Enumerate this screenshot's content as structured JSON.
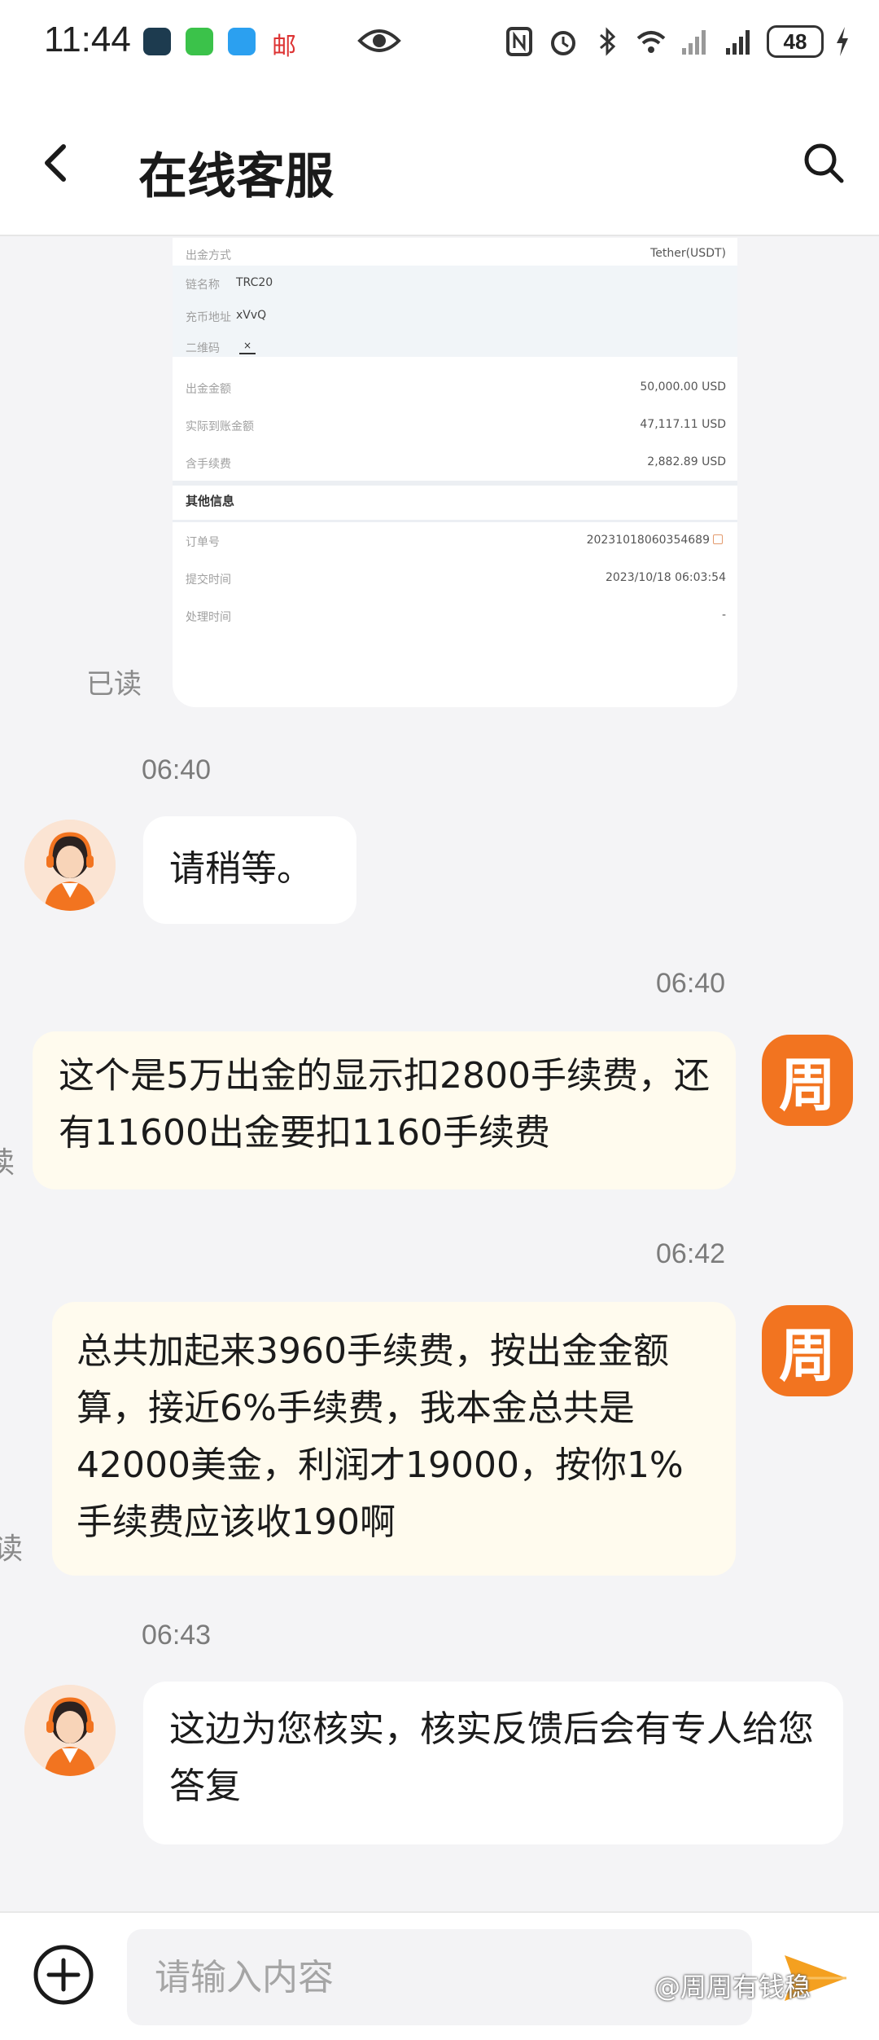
{
  "status_bar": {
    "time": "11:44",
    "mail_label": "邮",
    "battery": "48"
  },
  "header": {
    "title": "在线客服"
  },
  "receipt": {
    "rows_top": [
      {
        "key": "出金方式",
        "value": "Tether(USDT)"
      }
    ],
    "rows_info": [
      {
        "key": "链名称",
        "value": "TRC20"
      },
      {
        "key": "充币地址",
        "value": "xVvQ"
      },
      {
        "key": "二维码",
        "value": "×"
      }
    ],
    "rows_amount": [
      {
        "key": "出金金额",
        "value": "50,000.00 USD"
      },
      {
        "key": "实际到账金额",
        "value": "47,117.11 USD"
      },
      {
        "key": "含手续费",
        "value": "2,882.89 USD"
      }
    ],
    "other_section_title": "其他信息",
    "rows_other": [
      {
        "key": "订单号",
        "value": "20231018060354689"
      },
      {
        "key": "提交时间",
        "value": "2023/10/18 06:03:54"
      },
      {
        "key": "处理时间",
        "value": "-"
      }
    ]
  },
  "messages": [
    {
      "time": "06:40",
      "sender": "agent",
      "text": "请稍等。"
    },
    {
      "time": "06:40",
      "sender": "user",
      "text": "这个是5万出金的显示扣2800手续费，还有11600出金要扣1160手续费"
    },
    {
      "time": "06:42",
      "sender": "user",
      "text": "总共加起来3960手续费，按出金金额算，接近6%手续费，我本金总共是42000美金，利润才19000，按你1%手续费应该收190啊"
    },
    {
      "time": "06:43",
      "sender": "agent",
      "text": "这边为您核实，核实反馈后会有专人给您答复"
    }
  ],
  "read_label": "已读",
  "read_label_cut": "读",
  "read_label_cut2": "读",
  "user_avatar_char": "周",
  "input": {
    "placeholder": "请输入内容"
  },
  "watermark": "@周周有钱稳",
  "colors": {
    "accent_orange": "#f27420",
    "user_bubble": "#fffbee",
    "agent_bubble": "#ffffff",
    "background": "#f4f4f6"
  }
}
